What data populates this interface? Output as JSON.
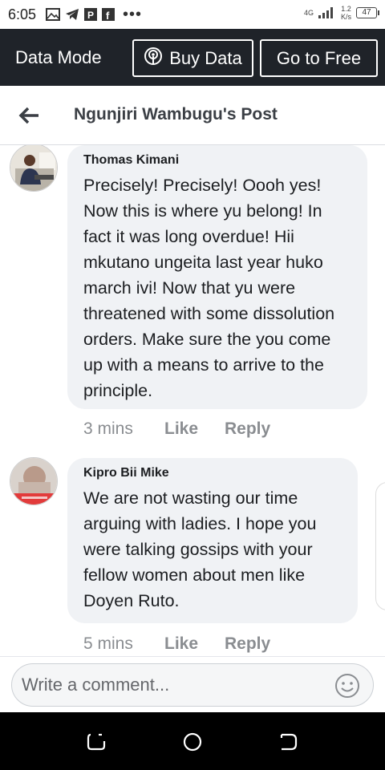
{
  "status_bar": {
    "time": "6:05",
    "network": "4G",
    "speed_value": "1.2",
    "speed_unit": "K/s",
    "battery": "47",
    "icons": [
      "gallery-icon",
      "telegram-icon",
      "p-icon",
      "facebook-icon"
    ]
  },
  "data_bar": {
    "mode_label": "Data Mode",
    "buy_label": "Buy Data",
    "free_label": "Go to Free"
  },
  "header": {
    "title": "Ngunjiri Wambugu's Post"
  },
  "comments": [
    {
      "author": "Thomas Kimani",
      "text": "Precisely! Precisely! Oooh yes! Now this is where yu belong! In fact it was long overdue! Hii mkutano ungeita last year huko march ivi! Now that yu were threatened with some dissolution orders. Make sure the you come up with a means to arrive to the principle.",
      "time": "3 mins",
      "like": "Like",
      "reply": "Reply"
    },
    {
      "author": "Kipro Bii Mike",
      "text": "We are not wasting our time arguing with ladies. I hope you were talking gossips with your fellow women about men like Doyen Ruto.",
      "time": "5 mins",
      "like": "Like",
      "reply": "Reply"
    }
  ],
  "composer": {
    "placeholder": "Write a comment..."
  },
  "colors": {
    "data_bar_bg": "#1f2329",
    "bubble_bg": "#f0f2f5",
    "meta_text": "#8a8d91"
  }
}
